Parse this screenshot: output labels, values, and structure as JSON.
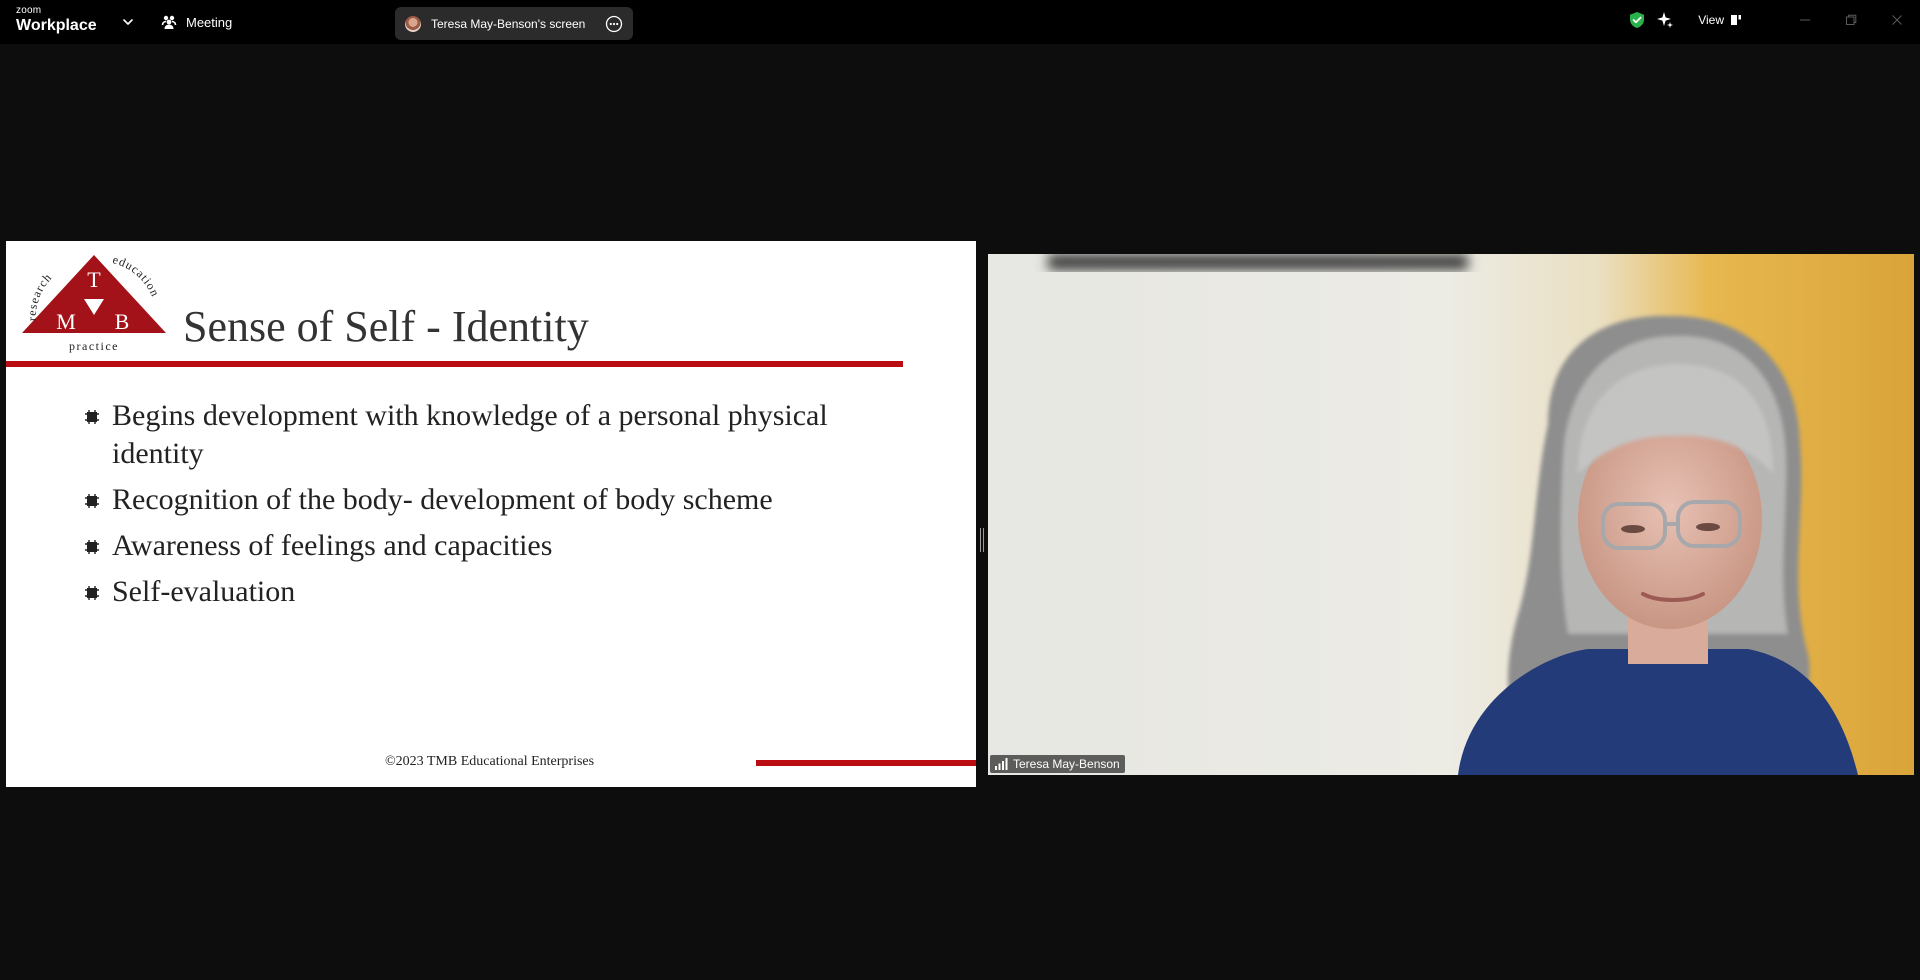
{
  "titlebar": {
    "brand_top": "zoom",
    "brand_bottom": "Workplace",
    "meeting_label": "Meeting",
    "share_label": "Teresa May-Benson's screen",
    "view_label": "View"
  },
  "slide": {
    "logo": {
      "top_letter": "T",
      "left_letter": "M",
      "right_letter": "B",
      "arc_left": "research",
      "arc_right": "education",
      "bottom_word": "practice"
    },
    "title": "Sense of Self - Identity",
    "bullets": [
      "Begins development with knowledge of a personal physical identity",
      "Recognition of the body- development of body scheme",
      "Awareness of feelings and capacities",
      "Self-evaluation"
    ],
    "footer": "©2023 TMB Educational Enterprises"
  },
  "participant": {
    "name": "Teresa May-Benson"
  },
  "colors": {
    "background": "#0d0d0d",
    "titlebar": "#000000",
    "accent_red": "#b90d12",
    "shield_green": "#2ab24a"
  },
  "icons": {
    "chevron": "chevron-down-icon",
    "meeting": "people-icon",
    "more": "more-icon",
    "security": "shield-check-icon",
    "ai": "sparkle-icon",
    "view": "view-layout-icon",
    "signal": "signal-icon"
  }
}
